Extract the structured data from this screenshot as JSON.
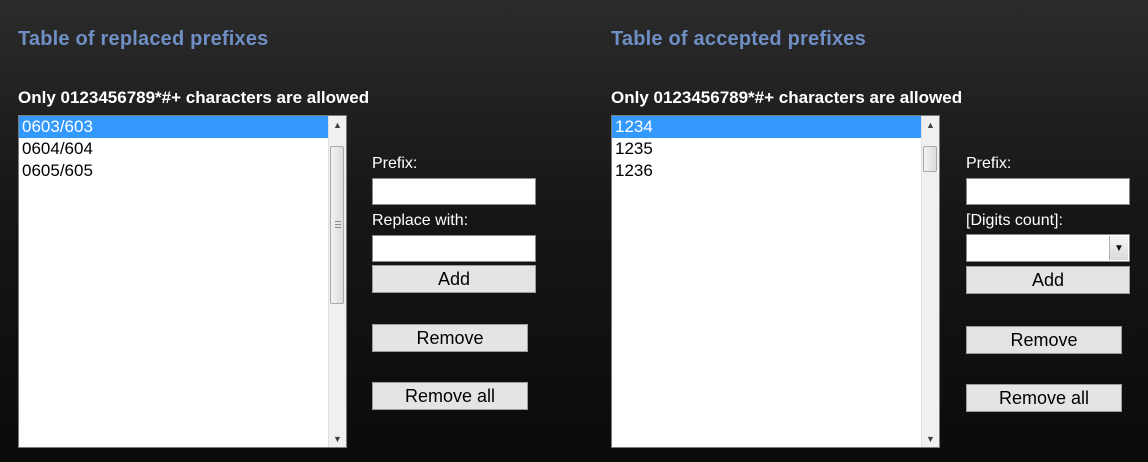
{
  "replaced": {
    "title": "Table of replaced prefixes",
    "hint": "Only 0123456789*#+ characters are allowed",
    "items": [
      "0603/603",
      "0604/604",
      "0605/605"
    ],
    "selected_index": 0,
    "prefix_label": "Prefix:",
    "prefix_value": "",
    "replace_label": "Replace with:",
    "replace_value": "",
    "add_label": "Add",
    "remove_label": "Remove",
    "remove_all_label": "Remove all"
  },
  "accepted": {
    "title": "Table of accepted prefixes",
    "hint": "Only 0123456789*#+ characters are allowed",
    "items": [
      "1234",
      "1235",
      "1236"
    ],
    "selected_index": 0,
    "prefix_label": "Prefix:",
    "prefix_value": "",
    "digits_label": "[Digits count]:",
    "digits_value": "",
    "add_label": "Add",
    "remove_label": "Remove",
    "remove_all_label": "Remove all"
  },
  "colors": {
    "title": "#6f8fc4",
    "selection": "#3399ff"
  }
}
